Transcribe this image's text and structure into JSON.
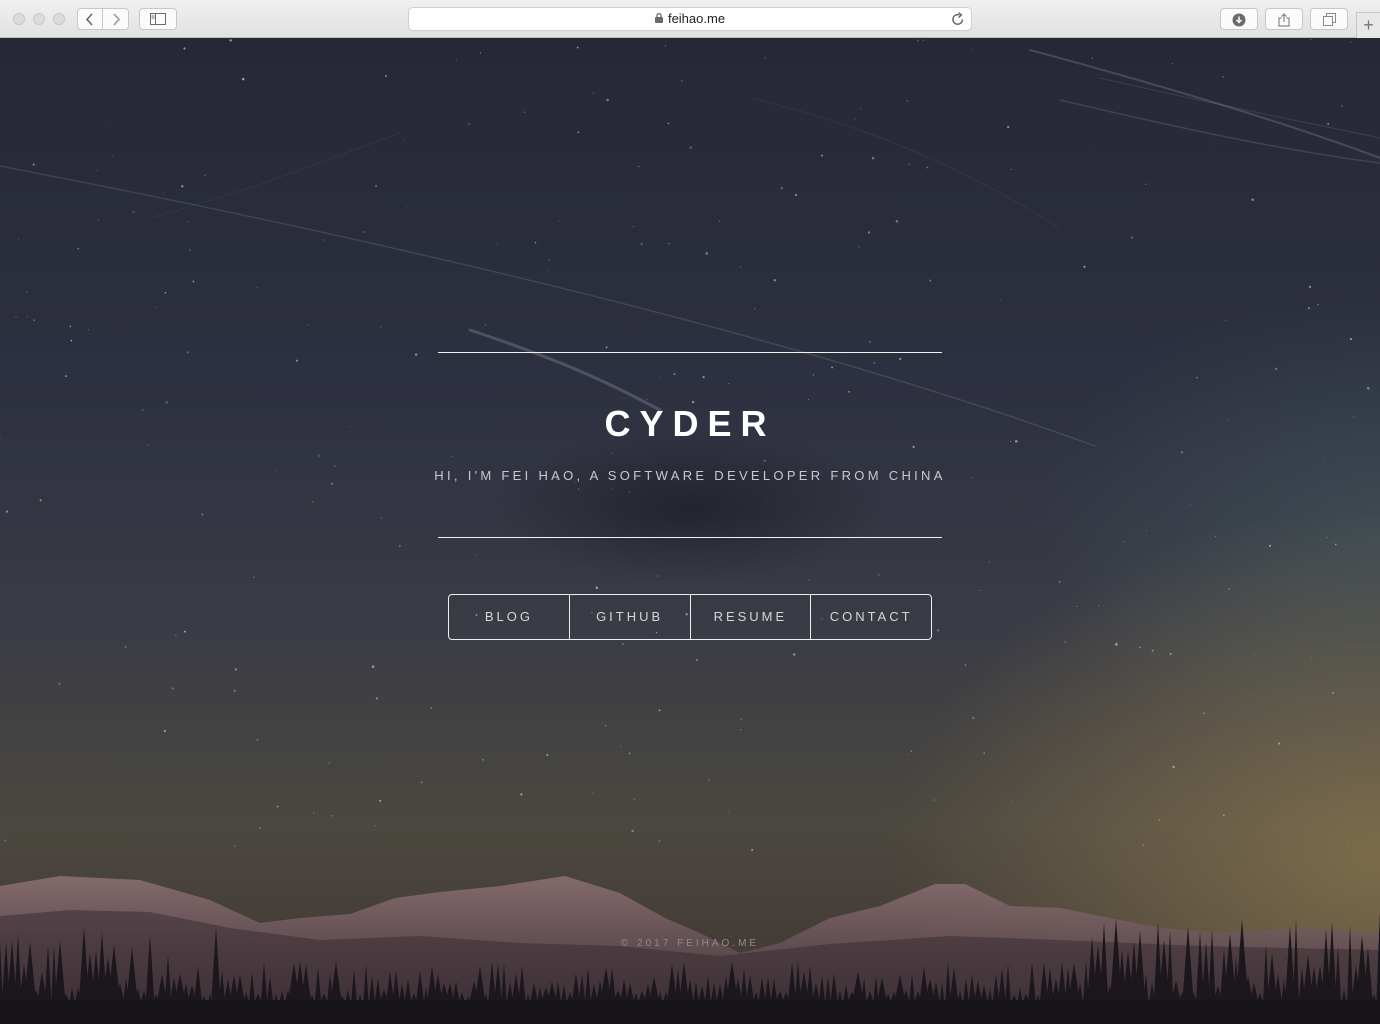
{
  "browser": {
    "url": "feihao.me",
    "new_tab_label": "+"
  },
  "hero": {
    "title": "CYDER",
    "subtitle": "HI, I'M FEI HAO, A SOFTWARE DEVELOPER FROM CHINA"
  },
  "nav": {
    "items": [
      {
        "label": "BLOG"
      },
      {
        "label": "GITHUB"
      },
      {
        "label": "RESUME"
      },
      {
        "label": "CONTACT"
      }
    ]
  },
  "footer": {
    "text": "© 2017 FEIHAO.ME"
  },
  "icons": {
    "back": "chevron-left-icon",
    "forward": "chevron-right-icon",
    "sidebar": "sidebar-icon",
    "lock": "lock-icon",
    "reload": "reload-icon",
    "download": "download-icon",
    "share": "share-icon",
    "tabs": "tabs-overview-icon"
  },
  "colors": {
    "page_top": "#262835",
    "page_bottom": "#3f3530",
    "text": "#ffffff",
    "muted_text": "#c9c9cc"
  }
}
